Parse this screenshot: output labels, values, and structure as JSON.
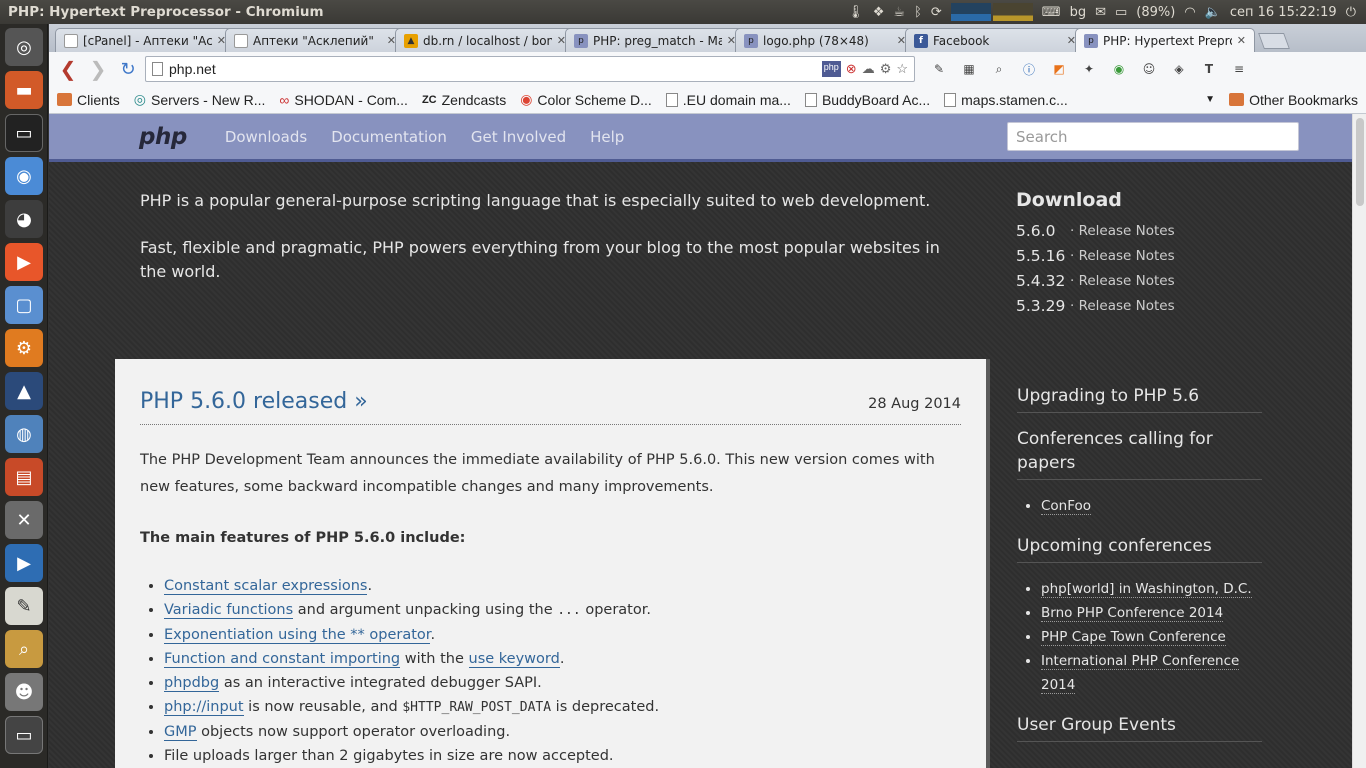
{
  "panel": {
    "window_title": "PHP: Hypertext Preprocessor - Chromium",
    "keyboard": "bg",
    "battery": "(89%)",
    "datetime": "сеп 16  15:22:19"
  },
  "tabs": [
    {
      "label": "[cPanel] - Аптеки \"Аскл",
      "active": false
    },
    {
      "label": "Аптеки \"Асклепий\"",
      "active": false
    },
    {
      "label": "db.rn / localhost / bone",
      "active": false
    },
    {
      "label": "PHP: preg_match - Man",
      "active": false
    },
    {
      "label": "logo.php (78×48)",
      "active": false
    },
    {
      "label": "Facebook",
      "active": false
    },
    {
      "label": "PHP: Hypertext Preproc",
      "active": true
    }
  ],
  "toolbar": {
    "url": "php.net"
  },
  "bookmarks": [
    {
      "label": "Clients",
      "icon": "folder"
    },
    {
      "label": "Servers - New R...",
      "icon": "globe"
    },
    {
      "label": "SHODAN - Com...",
      "icon": "shodan"
    },
    {
      "label": "Zendcasts",
      "icon": "zc"
    },
    {
      "label": "Color Scheme D...",
      "icon": "color"
    },
    {
      "label": ".EU domain ma...",
      "icon": "page"
    },
    {
      "label": "BuddyBoard Ac...",
      "icon": "page"
    },
    {
      "label": "maps.stamen.c...",
      "icon": "page"
    }
  ],
  "other_bookmarks": "Other Bookmarks",
  "php": {
    "logo": "php",
    "nav": [
      "Downloads",
      "Documentation",
      "Get Involved",
      "Help"
    ],
    "search_placeholder": "Search",
    "intro1": "PHP is a popular general-purpose scripting language that is especially suited to web development.",
    "intro2": "Fast, flexible and pragmatic, PHP powers everything from your blog to the most popular websites in the world.",
    "download_title": "Download",
    "versions": [
      {
        "ver": "5.6.0",
        "notes": "· Release Notes"
      },
      {
        "ver": "5.5.16",
        "notes": "· Release Notes"
      },
      {
        "ver": "5.4.32",
        "notes": "· Release Notes"
      },
      {
        "ver": "5.3.29",
        "notes": "· Release Notes"
      }
    ],
    "news": {
      "title": "PHP 5.6.0 released »",
      "date": "28 Aug 2014",
      "para": "The PHP Development Team announces the immediate availability of PHP 5.6.0. This new version comes with new features, some backward incompatible changes and many improvements.",
      "sub": "The main features of PHP 5.6.0 include:",
      "f1_link": "Constant scalar expressions",
      "f1_rest": ".",
      "f2_link": "Variadic functions",
      "f2_rest": " and argument unpacking using the ",
      "f2_code": "...",
      "f2_end": " operator.",
      "f3_link": "Exponentiation using the ** operator",
      "f3_rest": ".",
      "f4_link": "Function and constant importing",
      "f4_mid": " with the ",
      "f4_link2": "use keyword",
      "f4_rest": ".",
      "f5_link": "phpdbg",
      "f5_rest": " as an interactive integrated debugger SAPI.",
      "f6_link": "php://input",
      "f6_mid": " is now reusable, and ",
      "f6_code": "$HTTP_RAW_POST_DATA",
      "f6_rest": " is deprecated.",
      "f7_link": "GMP",
      "f7_rest": " objects now support operator overloading.",
      "f8": "File uploads larger than 2 gigabytes in size are now accepted."
    },
    "sidebar": {
      "h1": "Upgrading to PHP 5.6",
      "h2": "Conferences calling for papers",
      "cfp": [
        "ConFoo"
      ],
      "h3": "Upcoming conferences",
      "conf": [
        "php[world] in Washington, D.C.",
        "Brno PHP Conference 2014",
        "PHP Cape Town Conference",
        "International PHP Conference 2014"
      ],
      "h4": "User Group Events"
    }
  },
  "colors": {
    "php_nav": "#8892bf",
    "link": "#336699"
  }
}
